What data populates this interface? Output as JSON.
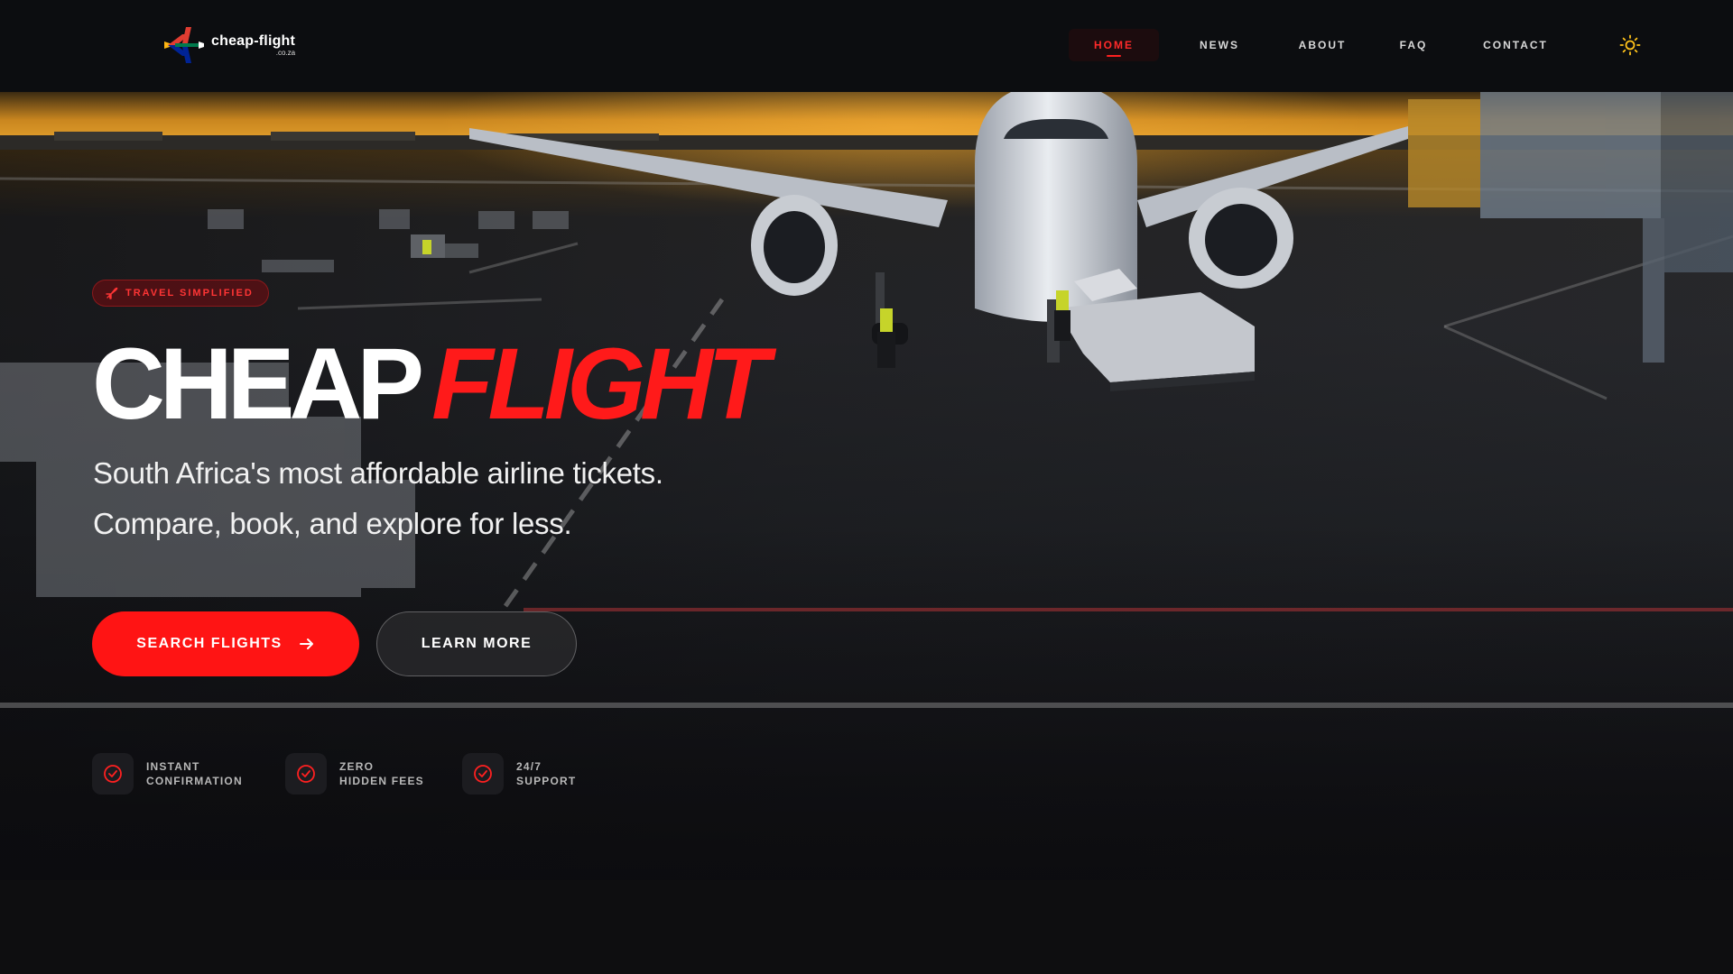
{
  "brand": {
    "name": "cheap-flight",
    "domain": ".co.za",
    "accent": "#ff1414"
  },
  "nav": {
    "items": [
      {
        "label": "HOME",
        "active": true
      },
      {
        "label": "NEWS",
        "active": false
      },
      {
        "label": "ABOUT",
        "active": false
      },
      {
        "label": "FAQ",
        "active": false
      },
      {
        "label": "CONTACT",
        "active": false
      }
    ],
    "theme_toggle_icon": "sun-icon"
  },
  "hero": {
    "badge": "TRAVEL SIMPLIFIED",
    "badge_icon": "plane-icon",
    "title_white": "CHEAP",
    "title_red": "FLIGHT",
    "subtitle_line1": "South Africa's most affordable airline tickets.",
    "subtitle_line2": "Compare, book, and explore for less.",
    "primary_button": "SEARCH FLIGHTS",
    "primary_button_icon": "arrow-right-icon",
    "secondary_button": "LEARN MORE"
  },
  "features": [
    {
      "line1": "INSTANT",
      "line2": "CONFIRMATION",
      "icon": "check-circle-icon"
    },
    {
      "line1": "ZERO",
      "line2": "HIDDEN FEES",
      "icon": "check-circle-icon"
    },
    {
      "line1": "24/7",
      "line2": "SUPPORT",
      "icon": "check-circle-icon"
    }
  ]
}
